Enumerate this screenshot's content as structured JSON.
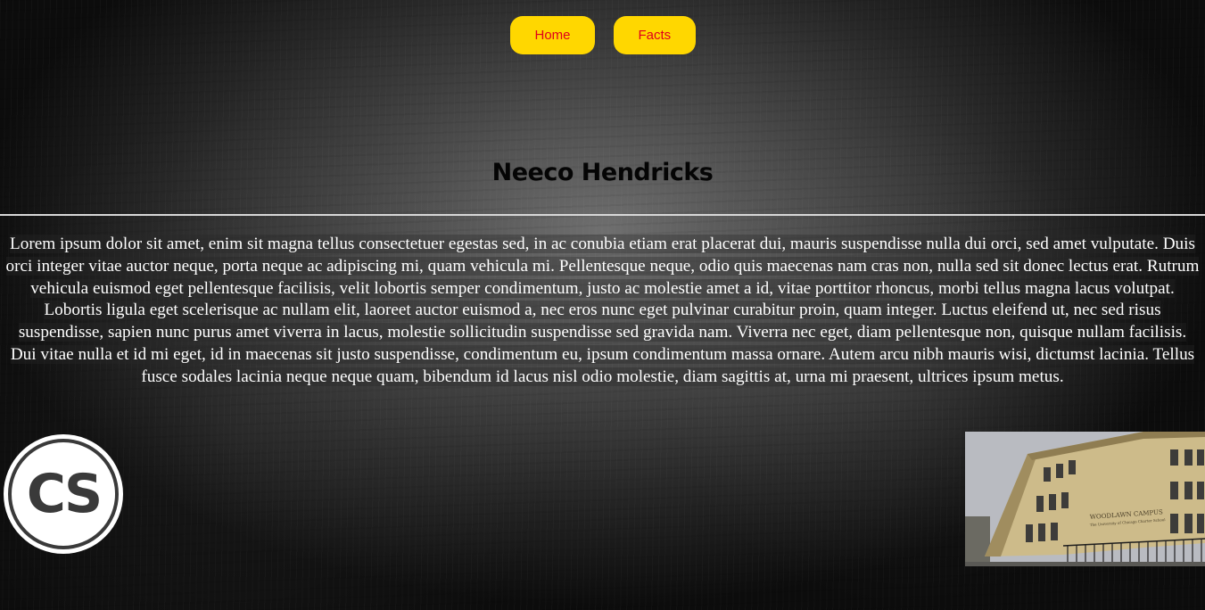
{
  "nav": {
    "home_label": "Home",
    "facts_label": "Facts"
  },
  "header": {
    "title": "Neeco Hendricks"
  },
  "main": {
    "paragraph": "Lorem ipsum dolor sit amet, enim sit magna tellus consectetuer egestas sed, in ac conubia etiam erat placerat dui, mauris suspendisse nulla dui orci, sed amet vulputate. Duis orci integer vitae auctor neque, porta neque ac adipiscing mi, quam vehicula mi. Pellentesque neque, odio quis maecenas nam cras non, nulla sed sit donec lectus erat. Rutrum vehicula euismod eget pellentesque facilisis, velit lobortis semper condimentum, justo ac molestie amet a id, vitae porttitor rhoncus, morbi tellus magna lacus volutpat. Lobortis ligula eget scelerisque ac nullam elit, laoreet auctor euismod a, nec eros nunc eget pulvinar curabitur proin, quam integer. Luctus eleifend ut, nec sed risus suspendisse, sapien nunc purus amet viverra in lacus, molestie sollicitudin suspendisse sed gravida nam. Viverra nec eget, diam pellentesque non, quisque nullam facilisis. Dui vitae nulla et id mi eget, id in maecenas sit justo suspendisse, condimentum eu, ipsum condimentum massa ornare. Autem arcu nibh mauris wisi, dictumst lacinia. Tellus fusce sodales lacinia neque neque quam, bibendum id lacus nisl odio molestie, diam sagittis at, urna mi praesent, ultrices ipsum metus."
  },
  "logo": {
    "letters": "CS"
  },
  "photo": {
    "sign_line1": "WOODLAWN CAMPUS",
    "sign_line2": "The University of Chicago Charter School"
  },
  "colors": {
    "button_bg": "#ffd700",
    "button_text": "#e0001b",
    "title_text": "#050505",
    "body_text": "#ffffff"
  }
}
